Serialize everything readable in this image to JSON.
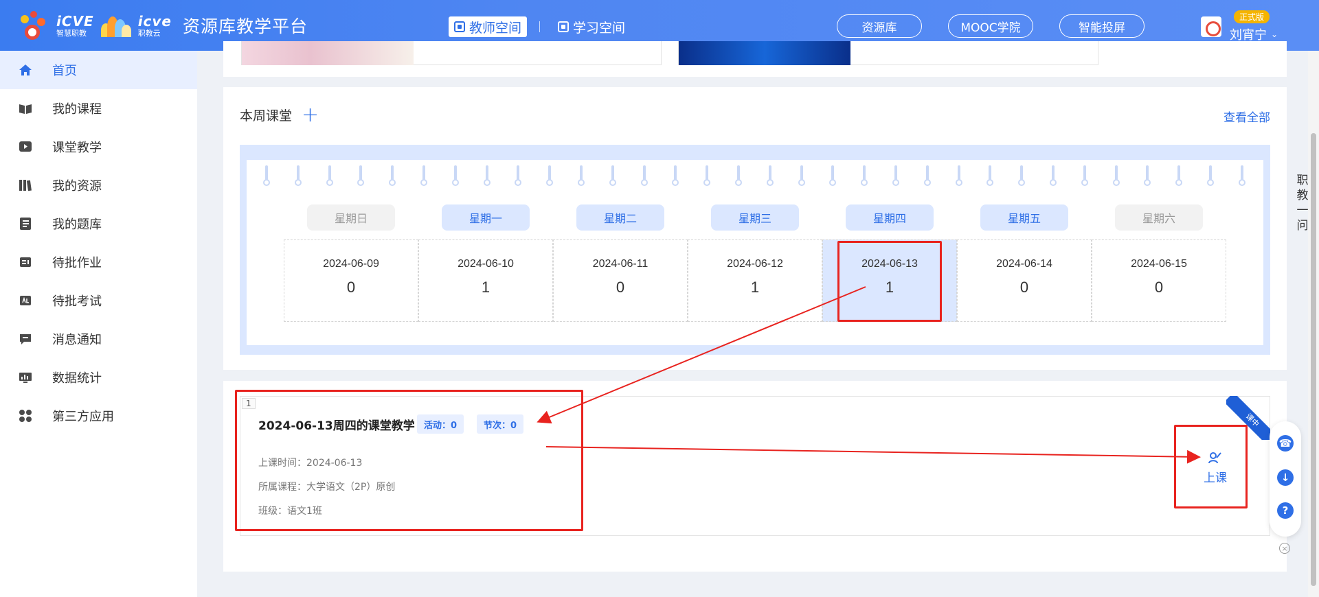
{
  "header": {
    "brand1_big": "iCVE",
    "brand1_small": "智慧职教",
    "brand2_big": "icve",
    "brand2_small": "职教云",
    "platform_title": "资源库教学平台",
    "spaces": [
      {
        "label": "教师空间",
        "active": true
      },
      {
        "label": "学习空间",
        "active": false
      }
    ],
    "links": [
      "资源库",
      "MOOC学院",
      "智能投屏"
    ],
    "user": {
      "badge": "正式版",
      "name": "刘宵宁"
    }
  },
  "sidebar": {
    "items": [
      {
        "label": "首页",
        "icon": "home-icon",
        "active": true
      },
      {
        "label": "我的课程",
        "icon": "book-icon"
      },
      {
        "label": "课堂教学",
        "icon": "play-icon"
      },
      {
        "label": "我的资源",
        "icon": "library-icon"
      },
      {
        "label": "我的题库",
        "icon": "question-bank-icon"
      },
      {
        "label": "待批作业",
        "icon": "homework-icon"
      },
      {
        "label": "待批考试",
        "icon": "exam-icon"
      },
      {
        "label": "消息通知",
        "icon": "message-icon"
      },
      {
        "label": "数据统计",
        "icon": "statistics-icon"
      },
      {
        "label": "第三方应用",
        "icon": "apps-icon"
      }
    ]
  },
  "week": {
    "title": "本周课堂",
    "view_all": "查看全部",
    "days": [
      {
        "weekday": "星期日",
        "date": "2024-06-09",
        "count": "0",
        "weekend": true
      },
      {
        "weekday": "星期一",
        "date": "2024-06-10",
        "count": "1"
      },
      {
        "weekday": "星期二",
        "date": "2024-06-11",
        "count": "0"
      },
      {
        "weekday": "星期三",
        "date": "2024-06-12",
        "count": "1"
      },
      {
        "weekday": "星期四",
        "date": "2024-06-13",
        "count": "1",
        "selected": true
      },
      {
        "weekday": "星期五",
        "date": "2024-06-14",
        "count": "0"
      },
      {
        "weekday": "星期六",
        "date": "2024-06-15",
        "count": "0",
        "weekend": true
      }
    ]
  },
  "lesson": {
    "index": "1",
    "title": "2024-06-13周四的课堂教学",
    "activity_tag": "活动：0",
    "session_tag": "节次：0",
    "time": "上课时间：2024-06-13",
    "course": "所属课程：大学语文（2P）原创",
    "class": "班级：语文1班",
    "ribbon": "课中",
    "start_label": "上课"
  },
  "side_tip": [
    "职",
    "教",
    "一",
    "问"
  ],
  "colors": {
    "accent": "#2f6fe6",
    "annotation": "#e8231f",
    "header": "#4f86f2",
    "badge": "#f5b400"
  }
}
